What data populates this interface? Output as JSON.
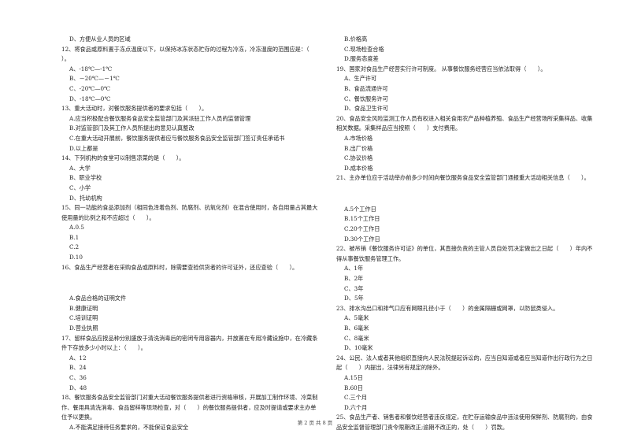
{
  "left_column": [
    {
      "type": "opt",
      "text": "D、方便从业人员的区域"
    },
    {
      "type": "q",
      "number": "12",
      "text": "12、将食品或原料置于冻点温度以下，以保持冰冻状态贮存的过程为冷冻，冷冻温度的范围应是：（　　）。"
    },
    {
      "type": "opt",
      "text": "A、-18℃—-1℃"
    },
    {
      "type": "opt",
      "text": "B、－20℃—－1℃"
    },
    {
      "type": "opt",
      "text": "C、-20℃—0℃"
    },
    {
      "type": "opt",
      "text": "D、-18℃—0℃"
    },
    {
      "type": "q",
      "number": "13",
      "text": "13、重大活动时，对餐饮服务提供者的要求包括（　　）。"
    },
    {
      "type": "opt",
      "text": "A.应当积极配合餐饮服务食品安全监管部门及其派驻工作人员的监督管理"
    },
    {
      "type": "opt",
      "text": "B.对监管部门及其工作人员所提出的意见认真整改"
    },
    {
      "type": "opt",
      "text": "C.在重大活动开展前，餐饮服务提供者应与餐饮服务食品安全监管部门签订责任承诺书"
    },
    {
      "type": "opt",
      "text": "D.以上都是"
    },
    {
      "type": "q",
      "number": "14",
      "text": "14、下列机构的食堂可以制售凉菜的是（　　）。"
    },
    {
      "type": "opt",
      "text": "A、大学"
    },
    {
      "type": "opt",
      "text": "B、职业学校"
    },
    {
      "type": "opt",
      "text": "C、小学"
    },
    {
      "type": "opt",
      "text": "D、托幼机构"
    },
    {
      "type": "q",
      "number": "15",
      "text": "15、同一功能的食品添加剂（相同色泽着色剂、防腐剂、抗氧化剂）在混合使用时，各自用量占其最大使用量的比例之和不应超过（　　）。"
    },
    {
      "type": "opt",
      "text": "A.0.5"
    },
    {
      "type": "opt",
      "text": "B.1"
    },
    {
      "type": "opt",
      "text": "C.2"
    },
    {
      "type": "opt",
      "text": "D.10"
    },
    {
      "type": "q",
      "number": "16",
      "text": "16、食品生产经营者在采购食品或原料时，除需要查验供货者的许可证外，还应查验（　　）。"
    },
    {
      "type": "gap",
      "text": ""
    },
    {
      "type": "opt",
      "text": "A.食品合格的证明文件"
    },
    {
      "type": "opt",
      "text": "B.健康证明"
    },
    {
      "type": "opt",
      "text": "C.培训证明"
    },
    {
      "type": "opt",
      "text": "D.营业执照"
    },
    {
      "type": "q",
      "number": "17",
      "text": "17、留样食品应按品种分别盛放于清洗消毒后的密闭专用容器内，并放置在专用冷藏设施中，在冷藏条件下存放多少小时以上：（　　）。"
    },
    {
      "type": "opt",
      "text": "A、12"
    },
    {
      "type": "opt",
      "text": "B、24"
    },
    {
      "type": "opt",
      "text": "C、36"
    },
    {
      "type": "opt",
      "text": "D、48"
    },
    {
      "type": "q",
      "number": "18",
      "text": "18、餐饮服务食品安全监管部门对重大活动餐饮服务提供者进行资格审核，开展加工制作环境、冷菜制作、餐用具清洗消毒、食品留样等现场检查，对（　　）的餐饮服务提供者，应及时提请或要求主办单位予以更换。"
    },
    {
      "type": "opt",
      "text": "A.不能满足接待任务要求的，不能保证食品安全"
    }
  ],
  "right_column": [
    {
      "type": "opt",
      "text": "B.价格高"
    },
    {
      "type": "opt",
      "text": "C.现场检查合格"
    },
    {
      "type": "opt",
      "text": "D.服务态度差"
    },
    {
      "type": "q",
      "number": "19",
      "text": "19、国家对食品生产经营实行许可制度。 从事餐饮服务经营应当依法取得（　　）。"
    },
    {
      "type": "opt",
      "text": "A、生产许可"
    },
    {
      "type": "opt",
      "text": "B、食品流通许可"
    },
    {
      "type": "opt",
      "text": "C、餐饮服务许可"
    },
    {
      "type": "opt",
      "text": "D、食品卫生许可"
    },
    {
      "type": "q",
      "number": "20",
      "text": "20、食品安全风险监测工作人员有权进入相关食用农产品种植养殖、食品生产经营场所采集样品、收集相关数据。采集样品应当按照（　　）支付费用。"
    },
    {
      "type": "opt",
      "text": "A.市场价格"
    },
    {
      "type": "opt",
      "text": "B.出厂价格"
    },
    {
      "type": "opt",
      "text": "C.协议价格"
    },
    {
      "type": "opt",
      "text": "D.成本价格"
    },
    {
      "type": "q",
      "number": "21",
      "text": "21、主办单位应于活动举办前多少时间向餐饮服务食品安全监管部门通报重大活动相关信息（　　）。"
    },
    {
      "type": "gap",
      "text": ""
    },
    {
      "type": "opt",
      "text": "A.5个工作日"
    },
    {
      "type": "opt",
      "text": "B.15个工作日"
    },
    {
      "type": "opt",
      "text": "C.20个工作日"
    },
    {
      "type": "opt",
      "text": "D.30个工作日"
    },
    {
      "type": "q",
      "number": "22",
      "text": "22、被吊销《餐饮服务许可证》的单位，其直接负责的主管人员自处罚决定做出之日起（　　）年内不得从事餐饮服务管理工作。"
    },
    {
      "type": "opt",
      "text": "A、1年"
    },
    {
      "type": "opt",
      "text": "B、2年"
    },
    {
      "type": "opt",
      "text": "C、3年"
    },
    {
      "type": "opt",
      "text": "D、5年"
    },
    {
      "type": "q",
      "number": "23",
      "text": "23、排水沟出口和排气口应有网眼孔径小于（　　）的金属隔栅或网罩，以防鼠类侵入。"
    },
    {
      "type": "opt",
      "text": "A、5毫米"
    },
    {
      "type": "opt",
      "text": "B、6毫米"
    },
    {
      "type": "opt",
      "text": "C、8毫米"
    },
    {
      "type": "opt",
      "text": "D、10毫米"
    },
    {
      "type": "q",
      "number": "24",
      "text": "24、公民、法人或者其他组织直接向人民法院提起诉讼的，应当自知道或者应当知道作出行政行为之日起（　　）内提出，法律另有规定的除外。"
    },
    {
      "type": "opt",
      "text": "A.15日"
    },
    {
      "type": "opt",
      "text": "B.60日"
    },
    {
      "type": "opt",
      "text": "C.三个月"
    },
    {
      "type": "opt",
      "text": "D.六个月"
    },
    {
      "type": "q",
      "number": "25",
      "text": "25、食品生产者、销售者和餐饮经营者违反规定，在贮存运输食品中违法使用保鲜剂、防腐剂的，由食品安全监督管理部门责令限期改正;逾期不改正的，处（　　）罚款。"
    }
  ],
  "footer": {
    "page_label": "第 2 页 共 8 页"
  }
}
